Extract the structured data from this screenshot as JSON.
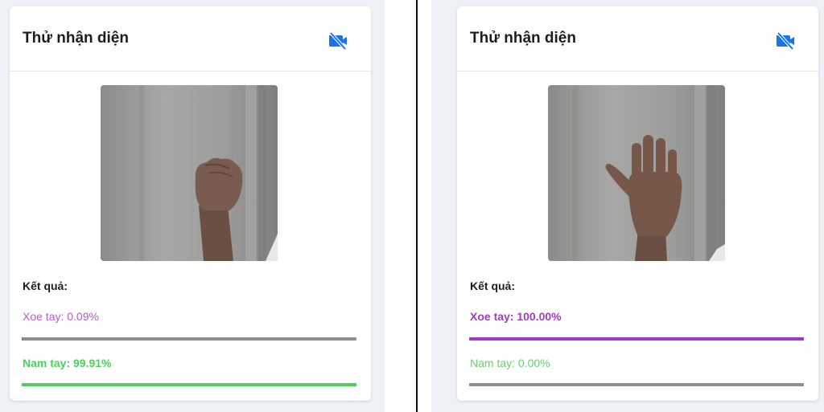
{
  "colors": {
    "xoe": "#a33bc2",
    "xoe_light": "#b05ecb",
    "nam": "#4ad25a",
    "nam_light": "#62d46d",
    "track": "#8f8f93",
    "camera_icon": "#1a73e8"
  },
  "panels": [
    {
      "title": "Thử nhận diện",
      "camera_icon": "video-off-icon",
      "preview_gesture": "fist",
      "result_label": "Kết quả:",
      "predictions": [
        {
          "label": "Xoe tay: 0.09%",
          "value": 0.0009,
          "active": false
        },
        {
          "label": "Nam tay: 99.91%",
          "value": 0.9991,
          "active": true
        }
      ]
    },
    {
      "title": "Thử nhận diện",
      "camera_icon": "video-off-icon",
      "preview_gesture": "open-palm",
      "result_label": "Kết quả:",
      "predictions": [
        {
          "label": "Xoe tay: 100.00%",
          "value": 1.0,
          "active": true
        },
        {
          "label": "Nam tay: 0.00%",
          "value": 0.0,
          "active": false
        }
      ]
    }
  ]
}
